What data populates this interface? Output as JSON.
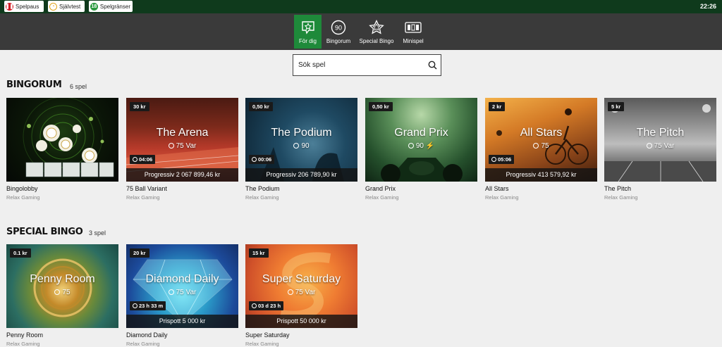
{
  "topbar": {
    "buttons": [
      {
        "label": "Spelpaus",
        "icon": "pause-icon",
        "color": "#d21f26"
      },
      {
        "label": "Självtest",
        "icon": "gauge-icon",
        "color": "#e0a21a"
      },
      {
        "label": "Spelgränser",
        "icon": "limits-icon",
        "color": "#2b9a3f"
      }
    ],
    "clock": "22:26"
  },
  "nav": {
    "items": [
      {
        "label": "För dig",
        "icon": "star-chat-icon",
        "active": true
      },
      {
        "label": "Bingorum",
        "icon": "ball-90-icon",
        "icon_text": "90"
      },
      {
        "label": "Special Bingo",
        "icon": "star-outline-icon"
      },
      {
        "label": "Minispel",
        "icon": "cards-icon"
      }
    ]
  },
  "search": {
    "placeholder": "Sök spel"
  },
  "bingorum": {
    "title": "BINGORUM",
    "count": "6 spel",
    "tiles": [
      {
        "name": "Bingolobby",
        "provider": "Relax Gaming"
      },
      {
        "name": "75 Ball Variant",
        "provider": "Relax Gaming",
        "price": "30 kr",
        "title": "The Arena",
        "sub": "75 Var",
        "timer": "04:06",
        "jackpot": "Progressiv 2 067 899,46 kr"
      },
      {
        "name": "The Podium",
        "provider": "Relax Gaming",
        "price": "0,50 kr",
        "title": "The Podium",
        "sub": "90",
        "timer": "00:06",
        "jackpot": "Progressiv 206 789,90 kr"
      },
      {
        "name": "Grand Prix",
        "provider": "Relax Gaming",
        "price": "0,50 kr",
        "title": "Grand Prix",
        "sub": "90 ⚡"
      },
      {
        "name": "All Stars",
        "provider": "Relax Gaming",
        "price": "2 kr",
        "title": "All Stars",
        "sub": "75",
        "timer": "05:06",
        "jackpot": "Progressiv 413 579,92 kr"
      },
      {
        "name": "The Pitch",
        "provider": "Relax Gaming",
        "price": "5 kr",
        "title": "The Pitch",
        "sub": "75 Var"
      }
    ]
  },
  "special": {
    "title": "SPECIAL BINGO",
    "count": "3 spel",
    "tiles": [
      {
        "name": "Penny Room",
        "provider": "Relax Gaming",
        "price": "0.1 kr",
        "title": "Penny Room",
        "sub": "75"
      },
      {
        "name": "Diamond Daily",
        "provider": "Relax Gaming",
        "price": "20 kr",
        "title": "Diamond Daily",
        "sub": "75 Var",
        "timer": "23 h 33 m",
        "jackpot": "Prispott 5 000 kr"
      },
      {
        "name": "Super Saturday",
        "provider": "Relax Gaming",
        "price": "15 kr",
        "title": "Super Saturday",
        "sub": "75 Var",
        "timer": "03 d 23 h",
        "jackpot": "Prispott 50 000 kr"
      }
    ]
  }
}
